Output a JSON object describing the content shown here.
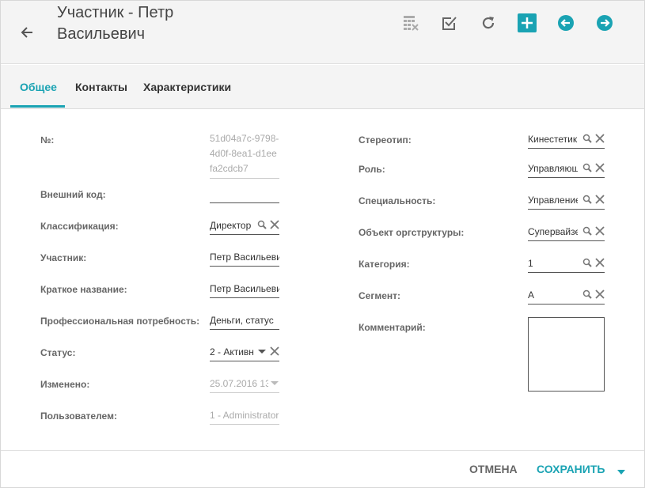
{
  "header": {
    "title": "Участник - Петр Васильевич",
    "accent": "#1aa3b3"
  },
  "tabs": [
    {
      "label": "Общее"
    },
    {
      "label": "Контакты"
    },
    {
      "label": "Характеристики"
    }
  ],
  "left": {
    "number_label": "№:",
    "number_value": "51d04a7c-9798-4d0f-8ea1-d1eefa2cdcb7",
    "external_code_label": "Внешний код:",
    "external_code_value": "",
    "classification_label": "Классификация:",
    "classification_value": "Директор",
    "participant_label": "Участник:",
    "participant_value": "Петр Васильеви",
    "short_name_label": "Краткое название:",
    "short_name_value": "Петр Васильеви",
    "prof_need_label": "Профессиональная потребность:",
    "prof_need_value": "Деньги, статус",
    "status_label": "Статус:",
    "status_value": "2 - Активн",
    "changed_label": "Изменено:",
    "changed_value": "25.07.2016 13",
    "user_label": "Пользователем:",
    "user_value": "1 - Administrator"
  },
  "right": {
    "stereotype_label": "Стереотип:",
    "stereotype_value": "Кинестетик",
    "role_label": "Роль:",
    "role_value": "Управляющ",
    "specialty_label": "Специальность:",
    "specialty_value": "Управление",
    "org_object_label": "Объект оргструктуры:",
    "org_object_value": "Супервайзе",
    "category_label": "Категория:",
    "category_value": "1",
    "segment_label": "Сегмент:",
    "segment_value": "А",
    "comment_label": "Комментарий:",
    "comment_value": ""
  },
  "footer": {
    "cancel": "ОТМЕНА",
    "save": "СОХРАНИТЬ"
  }
}
